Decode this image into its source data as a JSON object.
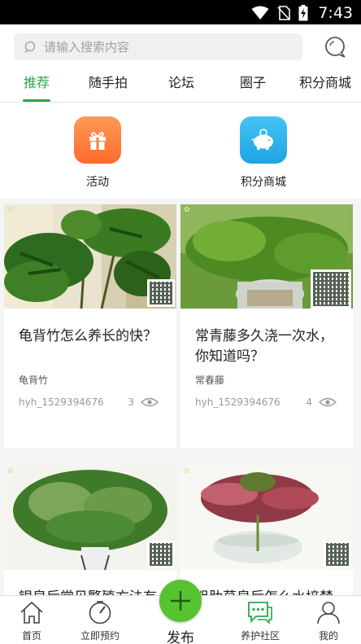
{
  "status_bar": {
    "time": "7:43"
  },
  "header": {
    "search_placeholder": "请输入搜索内容"
  },
  "tabs": [
    {
      "label": "推荐",
      "active": true
    },
    {
      "label": "随手拍",
      "active": false
    },
    {
      "label": "论坛",
      "active": false
    },
    {
      "label": "圈子",
      "active": false
    },
    {
      "label": "积分商城",
      "active": false
    }
  ],
  "quick_entries": [
    {
      "label": "活动",
      "icon": "gift-icon",
      "color": "#ff7d3c"
    },
    {
      "label": "积分商城",
      "icon": "piggy-bank-icon",
      "color": "#2ab2ec"
    }
  ],
  "posts": [
    {
      "title": "龟背竹怎么养长的快？",
      "tag": "龟背竹",
      "author": "hyh_1529394676",
      "views": "3"
    },
    {
      "title": "常青藤多久浇一次水，你知道吗？",
      "tag": "常春藤",
      "author": "hyh_1529394676",
      "views": "4"
    },
    {
      "title": "银皇后常见繁殖方法有",
      "tag": "",
      "author": "",
      "views": ""
    },
    {
      "title": "粗肋草皇后怎么水培禁上",
      "tag": "",
      "author": "",
      "views": ""
    }
  ],
  "bottom_nav": [
    {
      "label": "首页",
      "icon": "home-icon",
      "active": false
    },
    {
      "label": "立即预约",
      "icon": "timer-icon",
      "active": false
    },
    {
      "label": "发布",
      "icon": "plus-icon",
      "active": false
    },
    {
      "label": "养护社区",
      "icon": "community-chat-icon",
      "active": true
    },
    {
      "label": "我的",
      "icon": "profile-icon",
      "active": false
    }
  ],
  "colors": {
    "accent": "#2aa64b",
    "fab": "#57c331",
    "orange": "#ff7d3c",
    "blue": "#2ab2ec"
  }
}
